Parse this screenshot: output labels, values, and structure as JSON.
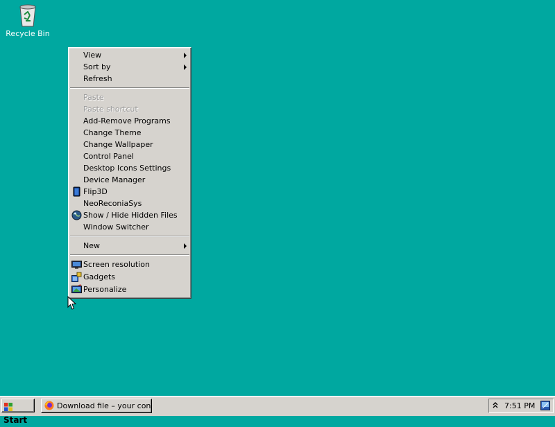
{
  "desktop": {
    "recycle_bin_label": "Recycle Bin",
    "background_color": "#00a8a0"
  },
  "context_menu": {
    "view": "View",
    "sort_by": "Sort by",
    "refresh": "Refresh",
    "paste": "Paste",
    "paste_shortcut": "Paste shortcut",
    "add_remove_programs": "Add-Remove Programs",
    "change_theme": "Change Theme",
    "change_wallpaper": "Change Wallpaper",
    "control_panel": "Control Panel",
    "desktop_icons_settings": "Desktop Icons Settings",
    "device_manager": "Device Manager",
    "flip3d": "Flip3D",
    "neoreconiasys": "NeoReconiaSys",
    "show_hide_hidden_files": "Show / Hide Hidden Files",
    "window_switcher": "Window Switcher",
    "new": "New",
    "screen_resolution": "Screen resolution",
    "gadgets": "Gadgets",
    "personalize": "Personalize"
  },
  "taskbar": {
    "start_label": "Start",
    "task_button_label": "Download file – your con…",
    "clock": "7:51 PM"
  }
}
